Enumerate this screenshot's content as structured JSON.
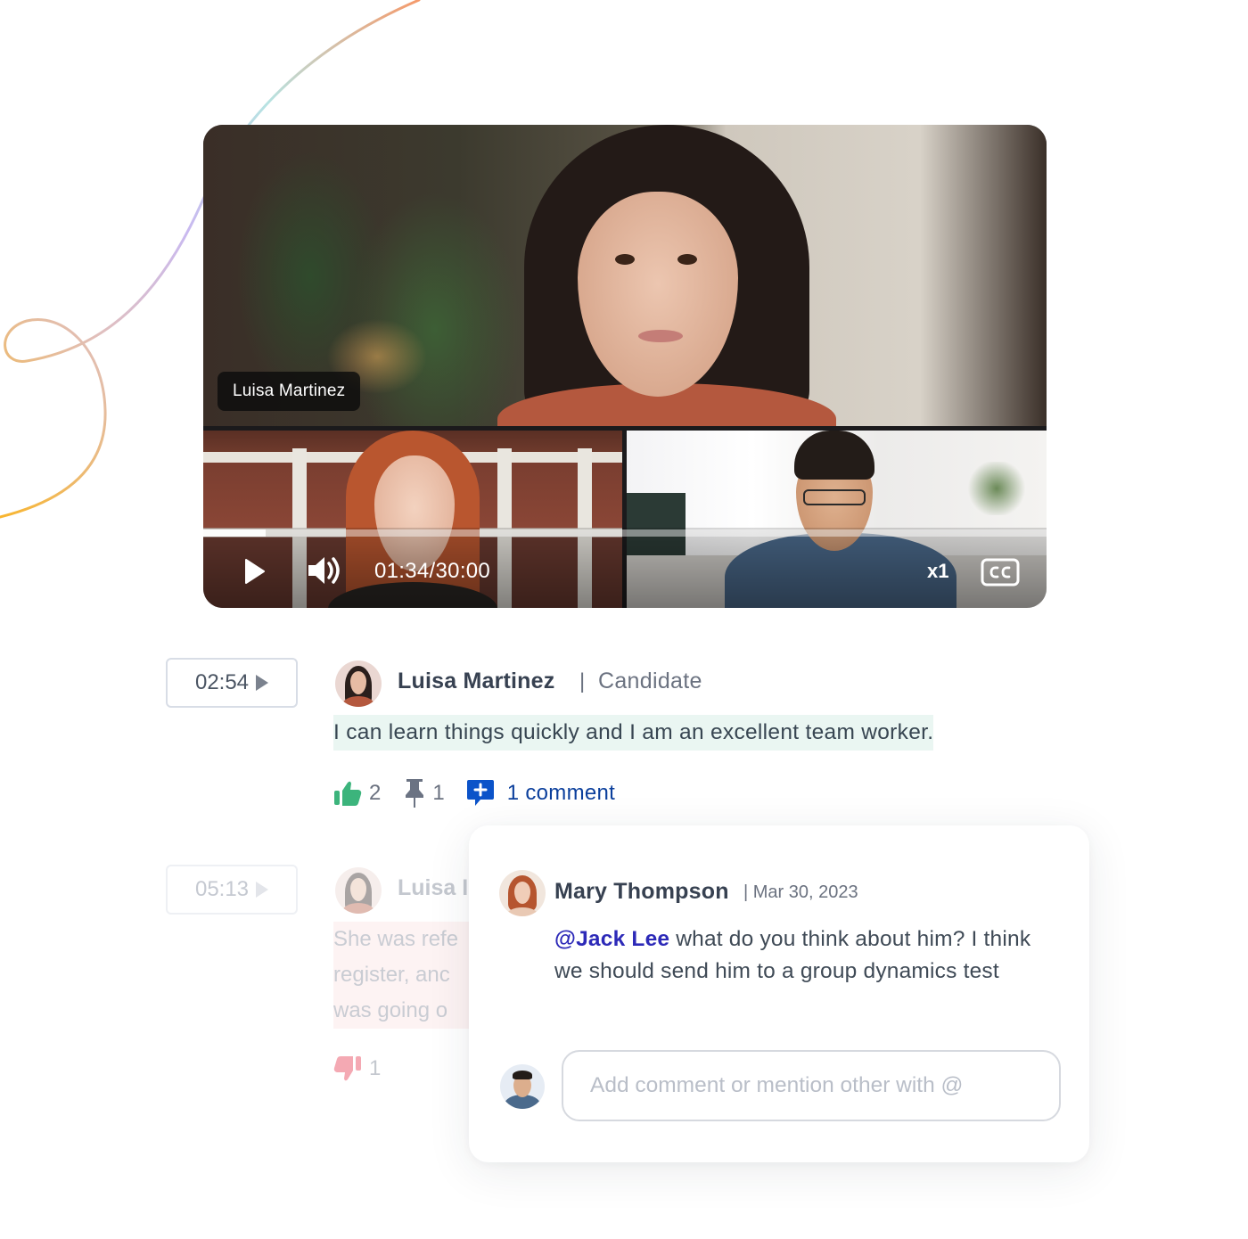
{
  "video": {
    "main_speaker_label": "Luisa Martinez",
    "time_current": "01:34",
    "time_total": "30:00",
    "time_readout": "01:34/30:00",
    "progress_fraction": 0.074,
    "speed_label": "x1",
    "icons": {
      "play": "play-icon",
      "volume": "volume-icon",
      "captions": "cc-icon"
    }
  },
  "transcript": {
    "entries": [
      {
        "timestamp": "02:54",
        "speaker": "Luisa Martinez",
        "separator": "|",
        "role": "Candidate",
        "text": "I can learn things quickly and I am an excellent team worker.",
        "highlight_color": "#eaf6f2",
        "reactions": {
          "likes": "2",
          "pins": "1",
          "comments_label": "1 comment"
        }
      },
      {
        "timestamp": "05:13",
        "speaker_partial": "Luisa I",
        "text_lines_partial": [
          "She was refe",
          "register, anc",
          "was going o"
        ],
        "highlight_color": "#fdf3f3",
        "reactions": {
          "dislikes": "1"
        }
      }
    ]
  },
  "comment_thread": {
    "comments": [
      {
        "author": "Mary Thompson",
        "date": "| Mar 30, 2023",
        "mention": "@Jack Lee",
        "text": " what do you think about him? I think we should send him to a group dynamics test"
      }
    ],
    "input": {
      "value": "",
      "placeholder": "Add comment or mention other with @"
    }
  },
  "colors": {
    "like_green": "#3cb47c",
    "pin_gray": "#6b7383",
    "comment_blue": "#0b53c9",
    "dislike_pink": "#f4a9b3",
    "mention_blue": "#2d2ab8"
  }
}
